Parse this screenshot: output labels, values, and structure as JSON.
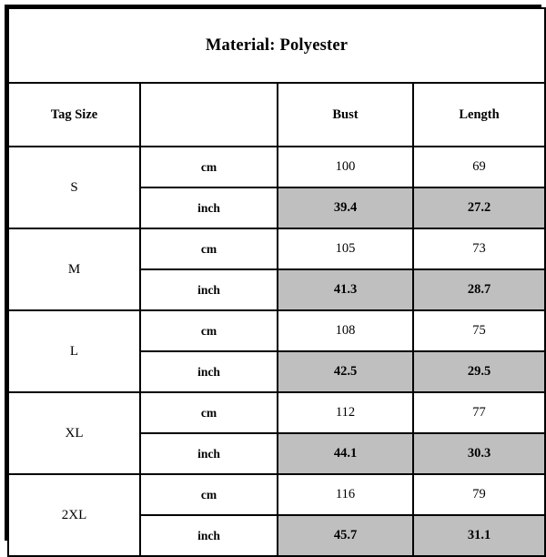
{
  "title": "Material: Polyester",
  "columns": {
    "size": "Tag Size",
    "unit": "",
    "bust": "Bust",
    "length": "Length"
  },
  "units": {
    "metric": "cm",
    "imperial": "inch"
  },
  "colors": {
    "shaded_row_background": "#bfbfbf",
    "border": "#000000",
    "cell_background": "#ffffff",
    "text": "#000000"
  },
  "rows": [
    {
      "size": "S",
      "cm": {
        "unit": "cm",
        "bust": "100",
        "length": "69"
      },
      "inch": {
        "unit": "inch",
        "bust": "39.4",
        "length": "27.2"
      }
    },
    {
      "size": "M",
      "cm": {
        "unit": "cm",
        "bust": "105",
        "length": "73"
      },
      "inch": {
        "unit": "inch",
        "bust": "41.3",
        "length": "28.7"
      }
    },
    {
      "size": "L",
      "cm": {
        "unit": "cm",
        "bust": "108",
        "length": "75"
      },
      "inch": {
        "unit": "inch",
        "bust": "42.5",
        "length": "29.5"
      }
    },
    {
      "size": "XL",
      "cm": {
        "unit": "cm",
        "bust": "112",
        "length": "77"
      },
      "inch": {
        "unit": "inch",
        "bust": "44.1",
        "length": "30.3"
      }
    },
    {
      "size": "2XL",
      "cm": {
        "unit": "cm",
        "bust": "116",
        "length": "79"
      },
      "inch": {
        "unit": "inch",
        "bust": "45.7",
        "length": "31.1"
      }
    }
  ],
  "chart_data": {
    "type": "table",
    "title": "Material: Polyester",
    "columns": [
      "Tag Size",
      "",
      "Bust",
      "Length"
    ],
    "categories": [
      "S",
      "M",
      "L",
      "XL",
      "2XL"
    ],
    "series": [
      {
        "name": "Bust (cm)",
        "values": [
          100,
          105,
          108,
          112,
          116
        ]
      },
      {
        "name": "Length (cm)",
        "values": [
          69,
          73,
          75,
          77,
          79
        ]
      },
      {
        "name": "Bust (inch)",
        "values": [
          39.4,
          41.3,
          42.5,
          44.1,
          45.7
        ]
      },
      {
        "name": "Length (inch)",
        "values": [
          27.2,
          28.7,
          29.5,
          30.3,
          31.1
        ]
      }
    ]
  }
}
